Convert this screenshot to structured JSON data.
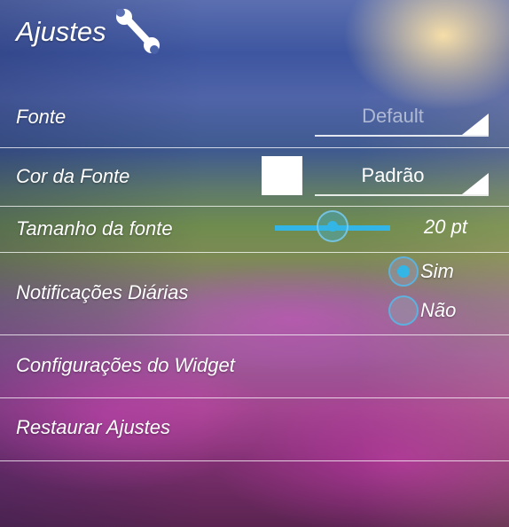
{
  "header": {
    "title": "Ajustes",
    "icon": "wrench-icon"
  },
  "font": {
    "label": "Fonte",
    "value": "Default"
  },
  "font_color": {
    "label": "Cor da Fonte",
    "swatch_color": "#ffffff",
    "value": "Padrão"
  },
  "font_size": {
    "label": "Tamanho da fonte",
    "value": "20 pt",
    "slider_fraction": 0.5
  },
  "daily_notifications": {
    "label": "Notificações Diárias",
    "options": [
      {
        "label": "Sim",
        "checked": true
      },
      {
        "label": "Não",
        "checked": false
      }
    ]
  },
  "widget_settings": {
    "label": "Configurações do Widget"
  },
  "restore_settings": {
    "label": "Restaurar Ajustes"
  },
  "colors": {
    "accent": "#33b5e5"
  }
}
